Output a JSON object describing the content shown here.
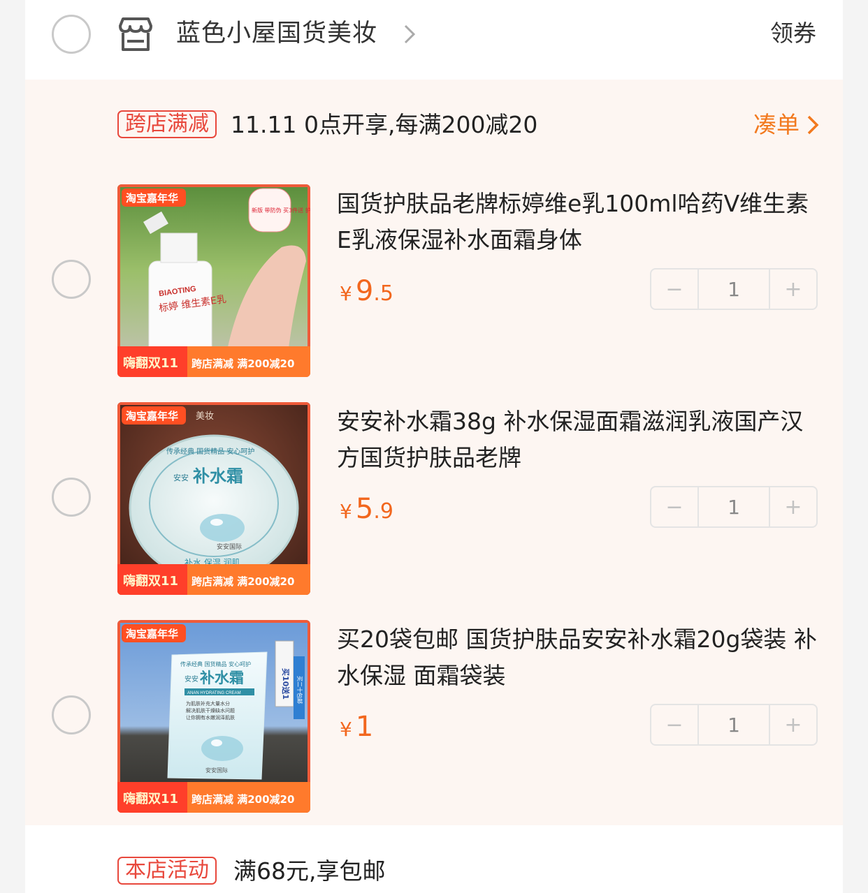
{
  "shop": {
    "name": "蓝色小屋国货美妆",
    "coupon_label": "领券"
  },
  "promo": {
    "tag": "跨店满减",
    "text": "11.11 0点开享,每满200减20",
    "addon_label": "凑单"
  },
  "items": [
    {
      "title": "国货护肤品老牌标婷维e乳100ml哈药V维生素E乳液保湿补水面霜身体",
      "price_symbol": "¥",
      "price_int": "9",
      "price_dec": ".5",
      "qty": "1",
      "thumb": {
        "badge": "淘宝嘉年华",
        "bottom_left": "嗨翻双11",
        "bottom_right": "跨店满减 满200减20",
        "corner_note": "新版 带防伪 买3件送 护手霜",
        "label_brand": "BIAOTING",
        "label_text": "标婷 维生素E乳"
      }
    },
    {
      "title": "安安补水霜38g 补水保湿面霜滋润乳液国产汉方国货护肤品老牌",
      "price_symbol": "¥",
      "price_int": "5",
      "price_dec": ".9",
      "qty": "1",
      "thumb": {
        "badge": "淘宝嘉年华",
        "bottom_left": "嗨翻双11",
        "bottom_right": "跨店满减 满200减20",
        "jar_text": "补水霜",
        "jar_small": "安安",
        "jar_ring": "传承经典 国货精品 安心呵护",
        "jar_brand": "安安国际",
        "jar_bottom": "补水 保湿 润肌",
        "watermark": "美妆"
      }
    },
    {
      "title": "买20袋包邮 国货护肤品安安补水霜20g袋装 补水保湿 面霜袋装",
      "price_symbol": "¥",
      "price_int": "1",
      "price_dec": "",
      "qty": "1",
      "thumb": {
        "badge": "淘宝嘉年华",
        "bottom_left": "嗨翻双11",
        "bottom_right": "跨店满减 满200减20",
        "pack_title": "补水霜",
        "pack_small": "安安",
        "pack_en": "ANAN HYDRATING CREAM",
        "pack_top": "传承经典 国货精品 安心呵护",
        "pack_desc1": "为肌肤补充大量水分",
        "pack_desc2": "解决肌肤干燥缺水问题",
        "pack_desc3": "让你拥有水嫩润泽肌肤",
        "pack_brand": "安安国际",
        "side_tag": "买10送1",
        "side_tag2": "买二十包邮"
      }
    }
  ],
  "stepper": {
    "minus": "−",
    "plus": "+"
  },
  "store_activity": {
    "tag": "本店活动",
    "text": "满68元,享包邮"
  },
  "colors": {
    "accent": "#f2671e",
    "tag_red": "#e8483c",
    "promo_bg": "#fdf6f2"
  }
}
